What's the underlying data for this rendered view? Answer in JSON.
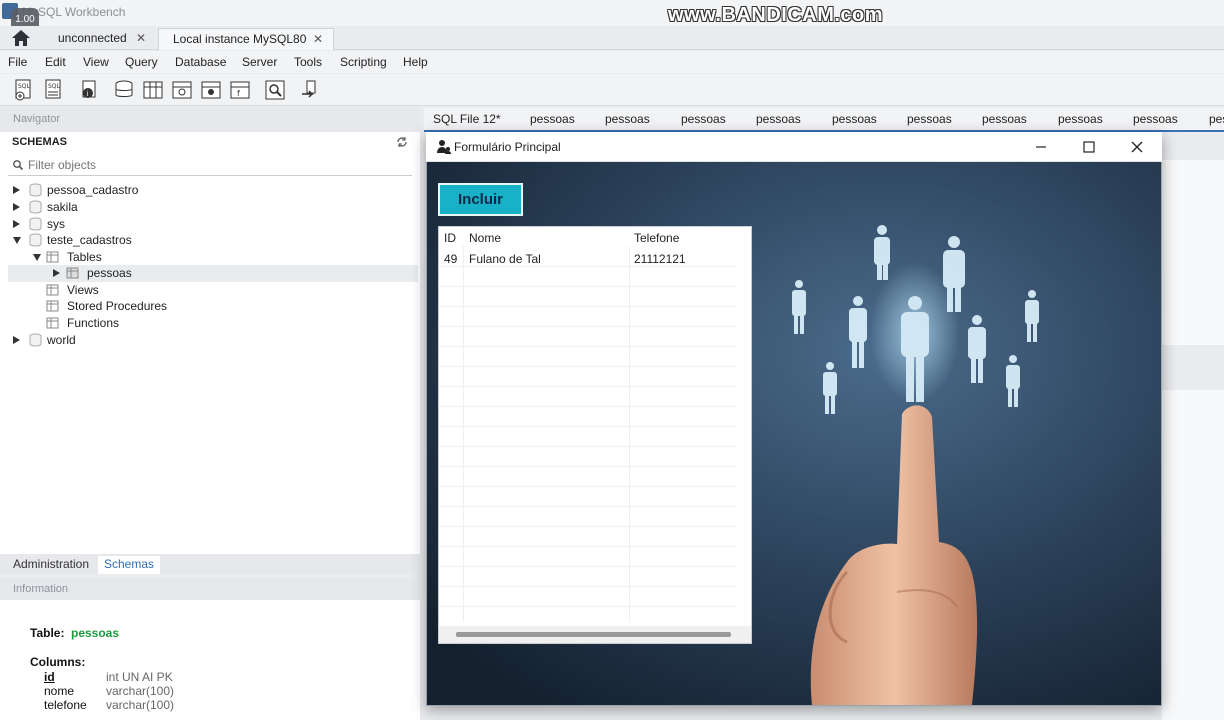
{
  "window": {
    "app_title": "MySQL Workbench",
    "speed_badge": "1.00",
    "watermark": "www.BANDICAM.com"
  },
  "connection_tabs": [
    {
      "label": "unconnected"
    },
    {
      "label": "Local instance MySQL80"
    }
  ],
  "menu": [
    "File",
    "Edit",
    "View",
    "Query",
    "Database",
    "Server",
    "Tools",
    "Scripting",
    "Help"
  ],
  "navigator": {
    "header": "Navigator",
    "schemas_title": "SCHEMAS",
    "filter_placeholder": "Filter objects",
    "tree": [
      {
        "label": "pessoa_cadastro"
      },
      {
        "label": "sakila"
      },
      {
        "label": "sys"
      },
      {
        "label": "teste_cadastros"
      },
      {
        "label": "Tables"
      },
      {
        "label": "pessoas"
      },
      {
        "label": "Views"
      },
      {
        "label": "Stored Procedures"
      },
      {
        "label": "Functions"
      },
      {
        "label": "world"
      }
    ],
    "bottom_tabs": [
      "Administration",
      "Schemas"
    ]
  },
  "information": {
    "header": "Information",
    "table_label": "Table:",
    "table_name": "pessoas",
    "columns_label": "Columns:",
    "columns": [
      {
        "name": "id",
        "type": "int UN AI PK"
      },
      {
        "name": "nome",
        "type": "varchar(100)"
      },
      {
        "name": "telefone",
        "type": "varchar(100)"
      }
    ]
  },
  "editor_tabs": [
    "SQL File 12*",
    "pessoas",
    "pessoas",
    "pessoas",
    "pessoas",
    "pessoas",
    "pessoas",
    "pessoas",
    "pessoas",
    "pessoas",
    "pes"
  ],
  "form": {
    "title": "Formulário Principal",
    "incluir_label": "Incluir",
    "grid": {
      "headers": [
        "ID",
        "Nome",
        "Telefone"
      ],
      "rows": [
        {
          "id": "49",
          "nome": "Fulano de Tal",
          "telefone": "21112121"
        }
      ]
    }
  },
  "colors": {
    "accent_tab": "#3b6fb6",
    "incluir_button": "#18b1c8",
    "info_table_name": "#1d9a3d"
  }
}
